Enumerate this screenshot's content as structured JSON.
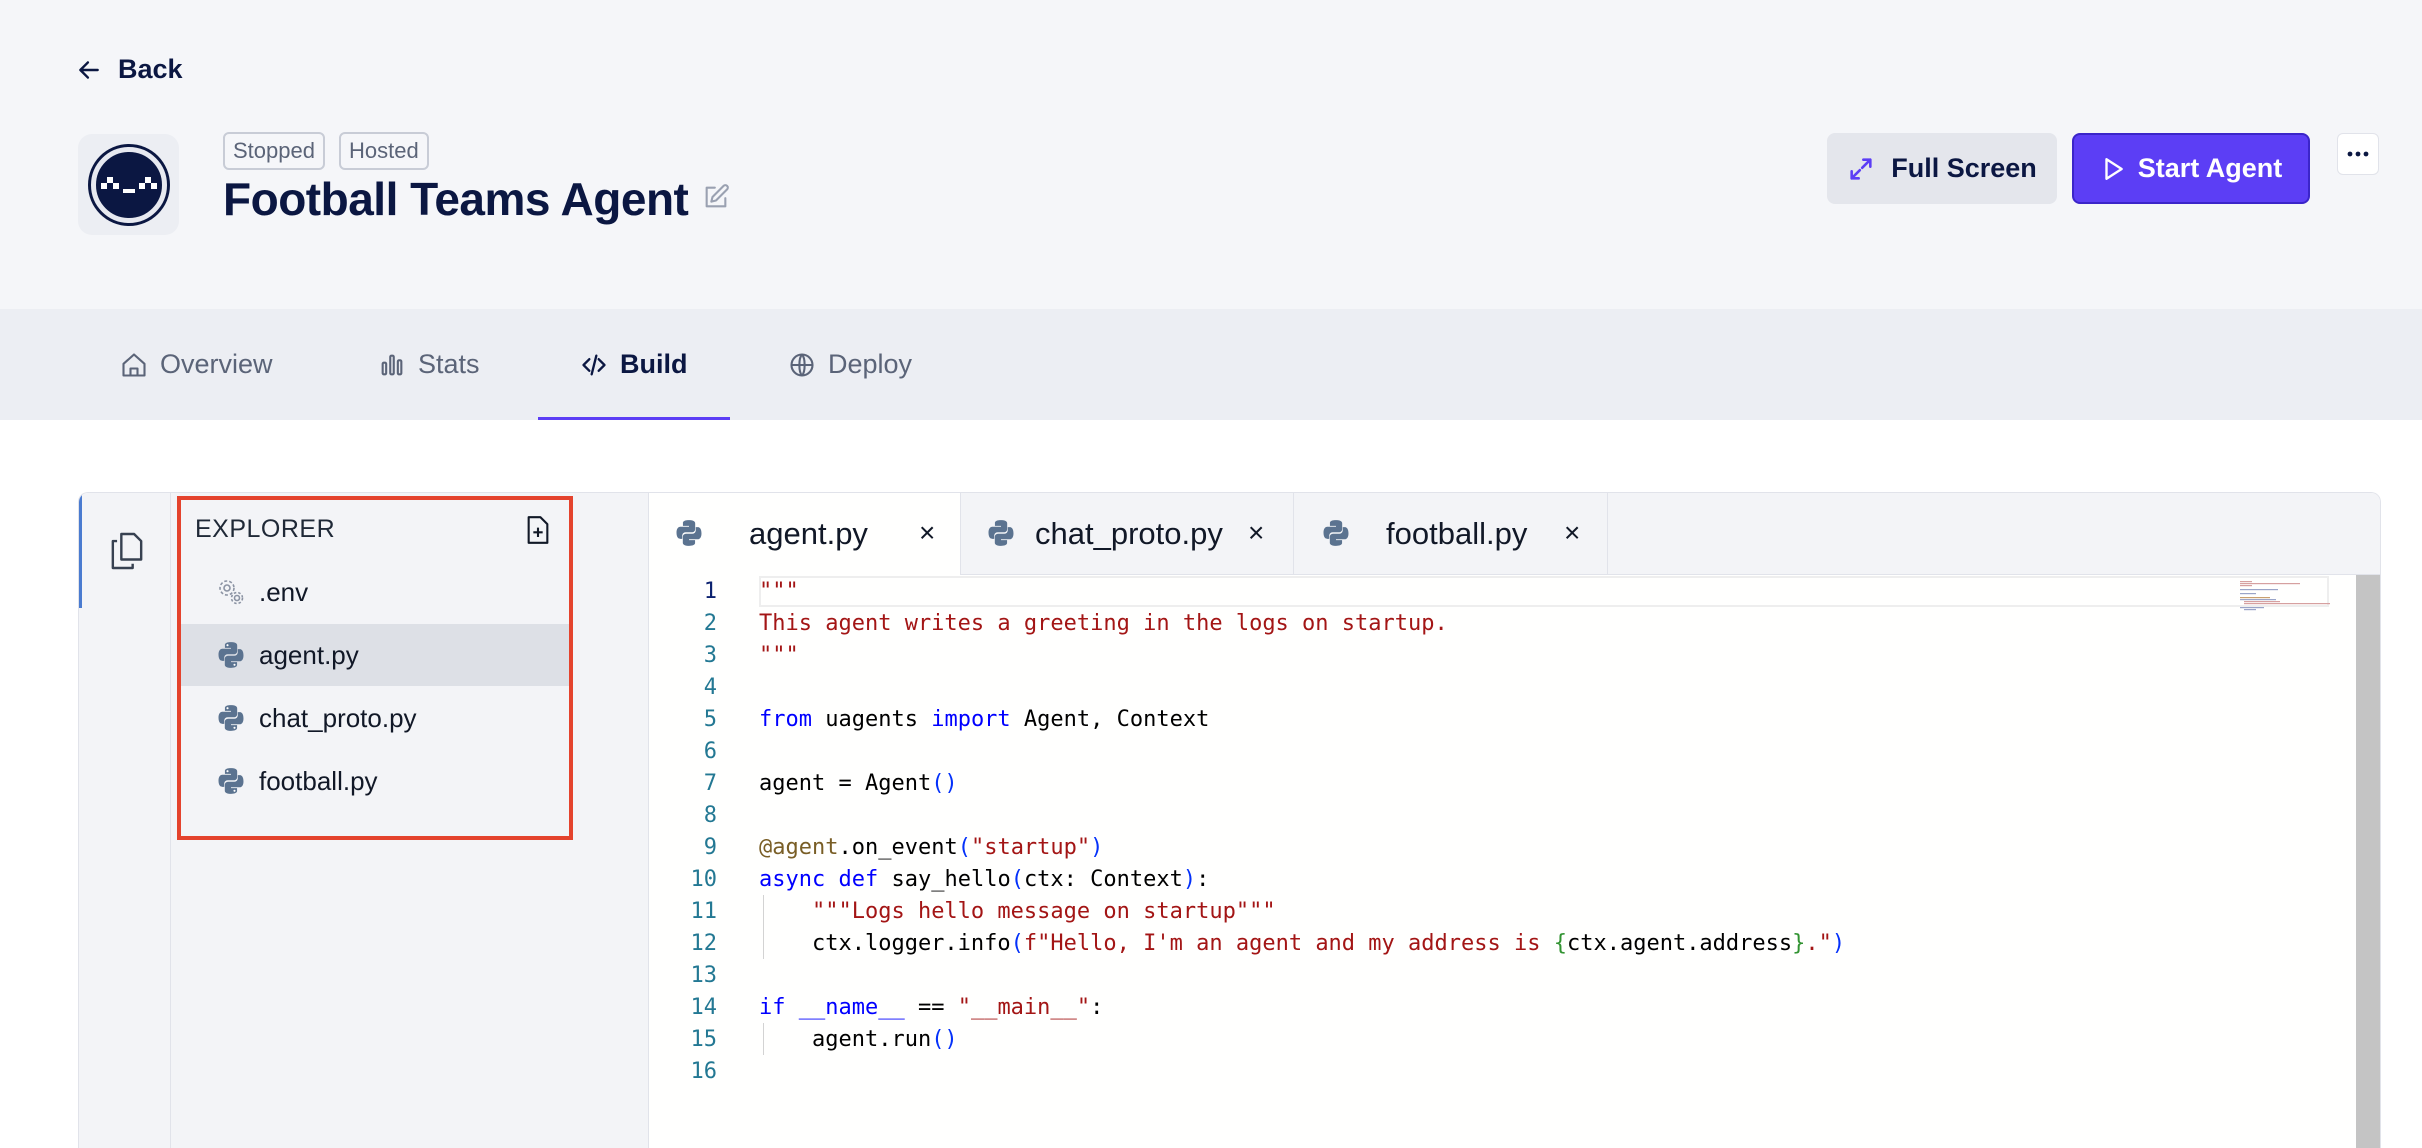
{
  "header": {
    "back_label": "Back",
    "badges": [
      "Stopped",
      "Hosted"
    ],
    "title": "Football Teams Agent",
    "fullscreen_label": "Full Screen",
    "start_label": "Start Agent"
  },
  "nav_tabs": [
    {
      "label": "Overview",
      "icon": "home-icon"
    },
    {
      "label": "Stats",
      "icon": "bar-chart-icon"
    },
    {
      "label": "Build",
      "icon": "code-icon",
      "active": true
    },
    {
      "label": "Deploy",
      "icon": "globe-icon"
    }
  ],
  "explorer": {
    "title": "EXPLORER",
    "files": [
      {
        "name": ".env",
        "icon": "gear-icon"
      },
      {
        "name": "agent.py",
        "icon": "python-icon",
        "selected": true
      },
      {
        "name": "chat_proto.py",
        "icon": "python-icon"
      },
      {
        "name": "football.py",
        "icon": "python-icon"
      }
    ]
  },
  "editor_tabs": [
    {
      "label": "agent.py",
      "active": true
    },
    {
      "label": "chat_proto.py"
    },
    {
      "label": "football.py"
    }
  ],
  "code": {
    "line_numbers": [
      "1",
      "2",
      "3",
      "4",
      "5",
      "6",
      "7",
      "8",
      "9",
      "10",
      "11",
      "12",
      "13",
      "14",
      "15",
      "16"
    ],
    "lines": [
      "\"\"\"",
      "This agent writes a greeting in the logs on startup.",
      "\"\"\"",
      "",
      "from uagents import Agent, Context",
      "",
      "agent = Agent()",
      "",
      "@agent.on_event(\"startup\")",
      "async def say_hello(ctx: Context):",
      "    \"\"\"Logs hello message on startup\"\"\"",
      "    ctx.logger.info(f\"Hello, I'm an agent and my address is {ctx.agent.address}.\")",
      "",
      "if __name__ == \"__main__\":",
      "    agent.run()",
      ""
    ]
  },
  "colors": {
    "accent": "#5c3ef5",
    "highlight_border": "#e4432d",
    "text_primary": "#0b1742"
  }
}
